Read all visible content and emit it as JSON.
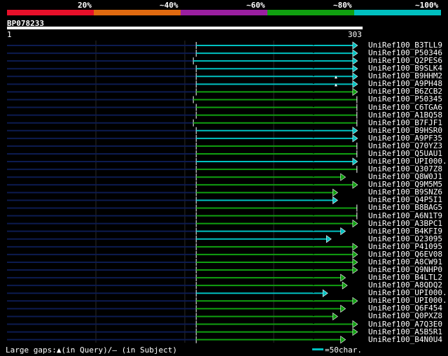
{
  "legend": [
    {
      "label": "20%",
      "color": "#e8102a"
    },
    {
      "label": "~40%",
      "color": "#e06a10"
    },
    {
      "label": "~60%",
      "color": "#9a1fa0"
    },
    {
      "label": "~80%",
      "color": "#10a010"
    },
    {
      "label": "~100%",
      "color": "#00c0c0"
    }
  ],
  "query": {
    "name": "BP078233",
    "start": "1",
    "end": "303"
  },
  "colors": {
    "cyan": "#00c0c0",
    "green": "#10a010",
    "navy": "#0c1b50",
    "white": "#ffffff",
    "black": "#000000"
  },
  "hits": [
    {
      "label": "UniRef100_B3TLL9",
      "color": "cyan",
      "start": 0.532,
      "end": 0.984,
      "arrow": true
    },
    {
      "label": "UniRef100_P50346",
      "color": "cyan",
      "start": 0.532,
      "end": 0.984,
      "arrow": true
    },
    {
      "label": "UniRef100_Q2PES6",
      "color": "cyan",
      "start": 0.524,
      "end": 0.984,
      "arrow": true
    },
    {
      "label": "UniRef100_B9SLK4",
      "color": "cyan",
      "start": 0.532,
      "end": 0.984,
      "arrow": true
    },
    {
      "label": "UniRef100_B9HHM2",
      "color": "cyan",
      "start": 0.532,
      "end": 0.984,
      "arrow": true,
      "gapmark": 0.925
    },
    {
      "label": "UniRef100_A9PH48",
      "color": "cyan",
      "start": 0.532,
      "end": 0.984,
      "arrow": true,
      "gapmark": 0.925
    },
    {
      "label": "UniRef100_B6ZCB2",
      "color": "green",
      "start": 0.532,
      "end": 0.984,
      "arrow": true
    },
    {
      "label": "UniRef100_P50345",
      "color": "green",
      "start": 0.524,
      "end": 0.984,
      "arrow": false
    },
    {
      "label": "UniRef100_C6TGA6",
      "color": "green",
      "start": 0.532,
      "end": 0.984,
      "arrow": false
    },
    {
      "label": "UniRef100_A1BQ58",
      "color": "green",
      "start": 0.532,
      "end": 0.984,
      "arrow": false
    },
    {
      "label": "UniRef100_B7FJF1",
      "color": "green",
      "start": 0.524,
      "end": 0.984,
      "arrow": false
    },
    {
      "label": "UniRef100_B9HSR0",
      "color": "cyan",
      "start": 0.532,
      "end": 0.984,
      "arrow": true
    },
    {
      "label": "UniRef100_A9PF35",
      "color": "cyan",
      "start": 0.532,
      "end": 0.984,
      "arrow": true
    },
    {
      "label": "UniRef100_Q70YZ3",
      "color": "green",
      "start": 0.532,
      "end": 0.984,
      "arrow": false
    },
    {
      "label": "UniRef100_Q5UAU1",
      "color": "green",
      "start": 0.532,
      "end": 0.984,
      "arrow": false
    },
    {
      "label": "UniRef100_UPI000..",
      "color": "cyan",
      "start": 0.532,
      "end": 0.984,
      "arrow": true
    },
    {
      "label": "UniRef100_Q307Z8",
      "color": "green",
      "start": 0.532,
      "end": 0.984,
      "arrow": false
    },
    {
      "label": "UniRef100_Q8W0J1",
      "color": "green",
      "start": 0.532,
      "end": 0.95,
      "arrow": true
    },
    {
      "label": "UniRef100_Q9M5M5",
      "color": "green",
      "start": 0.532,
      "end": 0.984,
      "arrow": true
    },
    {
      "label": "UniRef100_B9SNZ6",
      "color": "green",
      "start": 0.532,
      "end": 0.928,
      "arrow": true
    },
    {
      "label": "UniRef100_Q4P5I1",
      "color": "cyan",
      "start": 0.532,
      "end": 0.928,
      "arrow": true
    },
    {
      "label": "UniRef100_B8BAG5",
      "color": "green",
      "start": 0.532,
      "end": 0.984,
      "arrow": false
    },
    {
      "label": "UniRef100_A6N1T9",
      "color": "green",
      "start": 0.532,
      "end": 0.984,
      "arrow": false
    },
    {
      "label": "UniRef100_A3BPC1",
      "color": "green",
      "start": 0.532,
      "end": 0.984,
      "arrow": true
    },
    {
      "label": "UniRef100_B4KFI9",
      "color": "cyan",
      "start": 0.532,
      "end": 0.95,
      "arrow": true
    },
    {
      "label": "UniRef100_O23095",
      "color": "cyan",
      "start": 0.532,
      "end": 0.91,
      "arrow": true
    },
    {
      "label": "UniRef100_P41095",
      "color": "green",
      "start": 0.532,
      "end": 0.984,
      "arrow": true
    },
    {
      "label": "UniRef100_Q6EV08",
      "color": "green",
      "start": 0.532,
      "end": 0.984,
      "arrow": true
    },
    {
      "label": "UniRef100_A8CW91",
      "color": "green",
      "start": 0.532,
      "end": 0.984,
      "arrow": true
    },
    {
      "label": "UniRef100_Q9NHP0",
      "color": "green",
      "start": 0.532,
      "end": 0.984,
      "arrow": true
    },
    {
      "label": "UniRef100_B4LTL2",
      "color": "green",
      "start": 0.532,
      "end": 0.95,
      "arrow": true
    },
    {
      "label": "UniRef100_A8QDQ2",
      "color": "green",
      "start": 0.532,
      "end": 0.955,
      "arrow": true
    },
    {
      "label": "UniRef100_UPI000..",
      "color": "cyan",
      "start": 0.532,
      "end": 0.9,
      "arrow": true
    },
    {
      "label": "UniRef100_UPI000..",
      "color": "green",
      "start": 0.532,
      "end": 0.984,
      "arrow": true
    },
    {
      "label": "UniRef100_Q6F454",
      "color": "green",
      "start": 0.532,
      "end": 0.95,
      "arrow": true
    },
    {
      "label": "UniRef100_Q0PXZ8",
      "color": "green",
      "start": 0.532,
      "end": 0.928,
      "arrow": true
    },
    {
      "label": "UniRef100_A7Q3E0",
      "color": "green",
      "start": 0.532,
      "end": 0.984,
      "arrow": true
    },
    {
      "label": "UniRef100_A5B5R1",
      "color": "green",
      "start": 0.532,
      "end": 0.984,
      "arrow": true
    },
    {
      "label": "UniRef100_B4N0U4",
      "color": "green",
      "start": 0.532,
      "end": 0.95,
      "arrow": true
    }
  ],
  "footer": {
    "gaps_text": "Large gaps:▲(in Query)/– (in Subject)",
    "scale_text": "=50char."
  }
}
